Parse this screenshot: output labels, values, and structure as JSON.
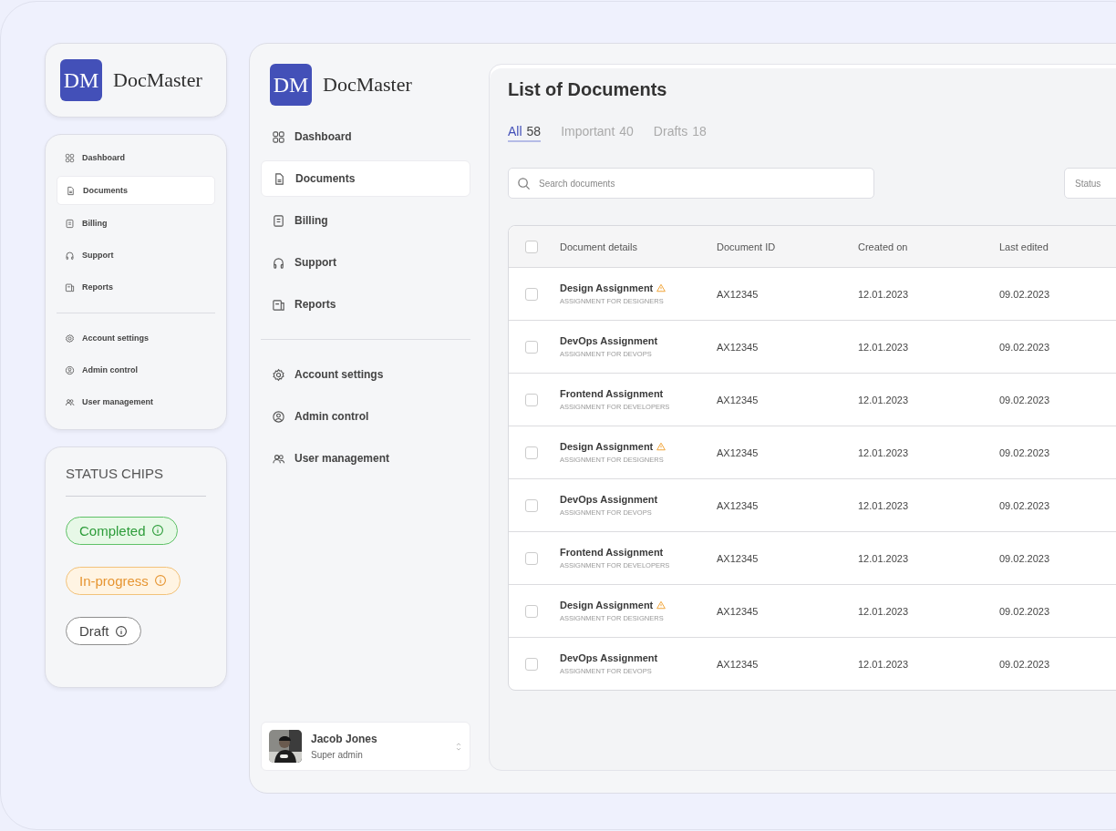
{
  "preview": {
    "logo": {
      "mark": "DM",
      "name": "DocMaster"
    },
    "nav": [
      {
        "label": "Dashboard",
        "selected": false
      },
      {
        "label": "Documents",
        "selected": true
      },
      {
        "label": "Billing",
        "selected": false
      },
      {
        "label": "Support",
        "selected": false
      },
      {
        "label": "Reports",
        "selected": false
      }
    ],
    "settings": [
      {
        "label": "Account settings",
        "selected": false
      },
      {
        "label": "Admin control",
        "selected": false
      },
      {
        "label": "User management",
        "selected": false
      }
    ],
    "status_chips": {
      "title": "STATUS CHIPS",
      "chips": [
        {
          "label": "Completed",
          "kind": "completed"
        },
        {
          "label": "In-progress",
          "kind": "progress"
        },
        {
          "label": "Draft",
          "kind": "draft"
        }
      ]
    }
  },
  "sidebar": {
    "logo": {
      "mark": "DM",
      "name": "DocMaster"
    },
    "nav": [
      {
        "label": "Dashboard",
        "selected": false
      },
      {
        "label": "Documents",
        "selected": true
      },
      {
        "label": "Billing",
        "selected": false
      },
      {
        "label": "Support",
        "selected": false
      },
      {
        "label": "Reports",
        "selected": false
      }
    ],
    "settings": [
      {
        "label": "Account settings",
        "selected": false
      },
      {
        "label": "Admin control",
        "selected": false
      },
      {
        "label": "User management",
        "selected": false
      }
    ],
    "user": {
      "name": "Jacob Jones",
      "role": "Super admin"
    }
  },
  "content": {
    "title": "List of Documents",
    "tabs": [
      {
        "label": "All",
        "count": "58",
        "selected": true
      },
      {
        "label": "Important",
        "count": "40",
        "selected": false
      },
      {
        "label": "Drafts",
        "count": "18",
        "selected": false
      }
    ],
    "search": {
      "placeholder": "Search documents"
    },
    "status_filter": {
      "placeholder": "Status"
    },
    "table": {
      "select_all": {
        "checked": false
      },
      "columns": [
        "Document details",
        "Document ID",
        "Created on",
        "Last edited"
      ],
      "rows": [
        {
          "title": "Design Assignment",
          "subtitle": "ASSIGNMENT FOR DESIGNERS",
          "warning": true,
          "id": "AX12345",
          "created": "12.01.2023",
          "edited": "09.02.2023",
          "checked": false
        },
        {
          "title": "DevOps Assignment",
          "subtitle": "ASSIGNMENT FOR DEVOPS",
          "warning": false,
          "id": "AX12345",
          "created": "12.01.2023",
          "edited": "09.02.2023",
          "checked": false
        },
        {
          "title": "Frontend Assignment",
          "subtitle": "ASSIGNMENT FOR DEVELOPERS",
          "warning": false,
          "id": "AX12345",
          "created": "12.01.2023",
          "edited": "09.02.2023",
          "checked": false
        },
        {
          "title": "Design Assignment",
          "subtitle": "ASSIGNMENT FOR DESIGNERS",
          "warning": true,
          "id": "AX12345",
          "created": "12.01.2023",
          "edited": "09.02.2023",
          "checked": false
        },
        {
          "title": "DevOps Assignment",
          "subtitle": "ASSIGNMENT FOR DEVOPS",
          "warning": false,
          "id": "AX12345",
          "created": "12.01.2023",
          "edited": "09.02.2023",
          "checked": false
        },
        {
          "title": "Frontend Assignment",
          "subtitle": "ASSIGNMENT FOR DEVELOPERS",
          "warning": false,
          "id": "AX12345",
          "created": "12.01.2023",
          "edited": "09.02.2023",
          "checked": false
        },
        {
          "title": "Design Assignment",
          "subtitle": "ASSIGNMENT FOR DESIGNERS",
          "warning": true,
          "id": "AX12345",
          "created": "12.01.2023",
          "edited": "09.02.2023",
          "checked": false
        },
        {
          "title": "DevOps Assignment",
          "subtitle": "ASSIGNMENT FOR DEVOPS",
          "warning": false,
          "id": "AX12345",
          "created": "12.01.2023",
          "edited": "09.02.2023",
          "checked": false
        }
      ]
    }
  }
}
